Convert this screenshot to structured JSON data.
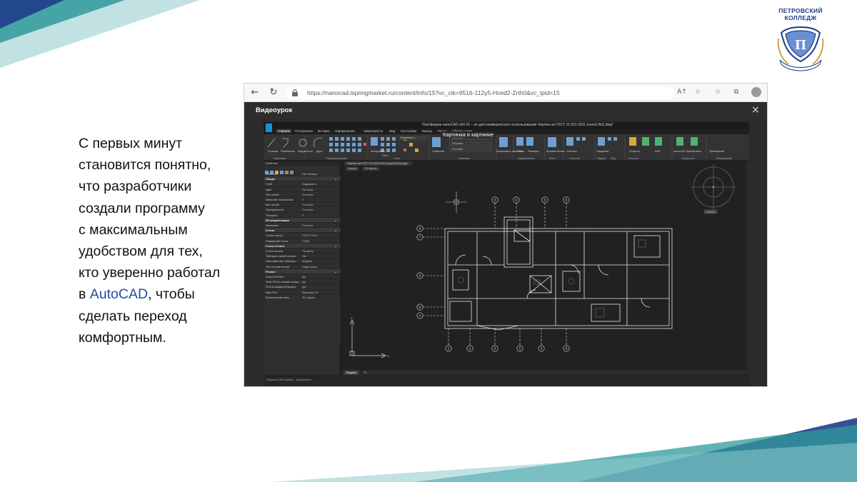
{
  "slide": {
    "lines": [
      {
        "text": "С первых минут"
      },
      {
        "text": "становится понятно,"
      },
      {
        "text": "что разработчики"
      },
      {
        "text": "создали программу"
      },
      {
        "text": "с максимальным"
      },
      {
        "text": "удобством для тех,"
      },
      {
        "text": "кто уверенно работал"
      },
      {
        "pre": "в ",
        "accent": "AutoCAD",
        "post": ", чтобы"
      },
      {
        "text": "сделать переход"
      },
      {
        "text": "комфортным."
      }
    ],
    "colors": {
      "text": "#111111",
      "accent": "#2a4a9e",
      "teal": "#2f9a9b",
      "navy": "#1f3d8a"
    }
  },
  "logo": {
    "line1": "ПЕТРОВСКИЙ",
    "line2": "КОЛЛЕДЖ",
    "ribbon_text": "LEARNING BY DOING",
    "icon": "college-crest-icon"
  },
  "browser": {
    "url": "https://nanocad.ispringmarket.ru/content/info/15?vc_cik=9516-112y5-Hced2-Zrth0&vc_lpid=15",
    "back_icon": "←",
    "reload_icon": "↻",
    "read_aloud_icon": "A↑",
    "star_icon": "☆",
    "favorites_icon": "☆",
    "collections_icon": "⧉"
  },
  "video": {
    "title": "Видеоурок",
    "close": "×"
  },
  "cad": {
    "window_title": "Платформа nanoCAD x64 22 – не для коммерческого использования Чертеж на ГОСТ 21.501-2011 (nanoCAD).dwg*",
    "popup_title": "Картинка в картинке",
    "tabs": [
      "Главная",
      "Построения",
      "Вставка",
      "Оформление",
      "Зависимости",
      "Вид",
      "Настройки",
      "Вывод",
      "Растр",
      "Облака точек"
    ],
    "ribbon_groups": [
      {
        "label": "Черчение"
      },
      {
        "label": "Редактирование"
      },
      {
        "label": "Слои"
      },
      {
        "label": "Свойства"
      },
      {
        "label": "Оформление"
      },
      {
        "label": "Блок"
      },
      {
        "label": "Утилиты"
      },
      {
        "label": "Буфер"
      },
      {
        "label": "Вид"
      },
      {
        "label": "Утилиты"
      },
      {
        "label": "Запустить"
      },
      {
        "label": "Расширения"
      }
    ],
    "ribbon_texts": [
      "Отрезок",
      "Полилиния",
      "Окружность",
      "Дуга",
      "Копировать",
      "Сеть",
      "Свойства",
      "По слою",
      "Копировать свойства",
      "Текст",
      "Размеры",
      "Вставка блока",
      "Утилиты",
      "Сведения",
      "Открыть",
      "NSS",
      "nanoCAD Specification",
      "Требования"
    ],
    "layer_value": "Видимые к...",
    "properties_header": "Свойства",
    "properties_object": "Нет выбора",
    "properties": [
      {
        "key": "Объекты",
        "val": "Нет выбора",
        "section": false
      },
      {
        "key": "Общие",
        "val": "",
        "section": true
      },
      {
        "key": "Слой",
        "val": "Видимые к...",
        "section": false
      },
      {
        "key": "Цвет",
        "val": "По слою",
        "section": false
      },
      {
        "key": "Тип линий",
        "val": "По слою",
        "section": false
      },
      {
        "key": "Масштаб типа линий",
        "val": "1",
        "section": false
      },
      {
        "key": "Вес линий",
        "val": "По слою",
        "section": false
      },
      {
        "key": "Прозрачность",
        "val": "По слою",
        "section": false
      },
      {
        "key": "Толщина",
        "val": "0",
        "section": false
      },
      {
        "key": "3D визуализация",
        "val": "",
        "section": true
      },
      {
        "key": "Материал",
        "val": "По слою",
        "section": false
      },
      {
        "key": "Стили",
        "val": "",
        "section": true
      },
      {
        "key": "Стиль текста",
        "val": "ГОСТ 2.304",
        "section": false
      },
      {
        "key": "Размерный стиль",
        "val": "СПДС",
        "section": false
      },
      {
        "key": "Стиль печати",
        "val": "",
        "section": true
      },
      {
        "key": "Стиль печати",
        "val": "По цвету",
        "section": false
      },
      {
        "key": "Таблица стилей печати",
        "val": "Нет",
        "section": false
      },
      {
        "key": "Пространство таблицы...",
        "val": "Модель",
        "section": false
      },
      {
        "key": "Тип стилей печати",
        "val": "Недоступно",
        "section": false
      },
      {
        "key": "Разное",
        "val": "",
        "section": true
      },
      {
        "key": "Знак ПСК Вкл",
        "val": "Да",
        "section": false
      },
      {
        "key": "Знак ПСК в начале коорд...",
        "val": "Да",
        "section": false
      },
      {
        "key": "ПСК в каждом ВЭкране",
        "val": "Да",
        "section": false
      },
      {
        "key": "Имя ПСК",
        "val": "Мировая СК",
        "section": false
      },
      {
        "key": "Визуальный стиль",
        "val": "2D каркас",
        "section": false
      }
    ],
    "document_tab": "Чертеж на ГОСТ 21.501-2011 (nanoCAD).dwg*",
    "view_buttons": [
      "Сверху",
      "2D каркас"
    ],
    "layout_tabs": [
      "Модель",
      "Л1"
    ],
    "command_line": "Открыть DWG-файл ... Выполнено",
    "drawing_color": "#dddddd",
    "background_color": "#212121"
  },
  "plan": {
    "top_axes": [
      "3",
      "4",
      "5",
      "6"
    ],
    "bottom_axes": [
      "1",
      "2",
      "3",
      "5",
      "6",
      "8"
    ],
    "left_axes": [
      "8",
      "7",
      "5",
      "Б",
      "А"
    ],
    "nav_label": "Сверху"
  }
}
